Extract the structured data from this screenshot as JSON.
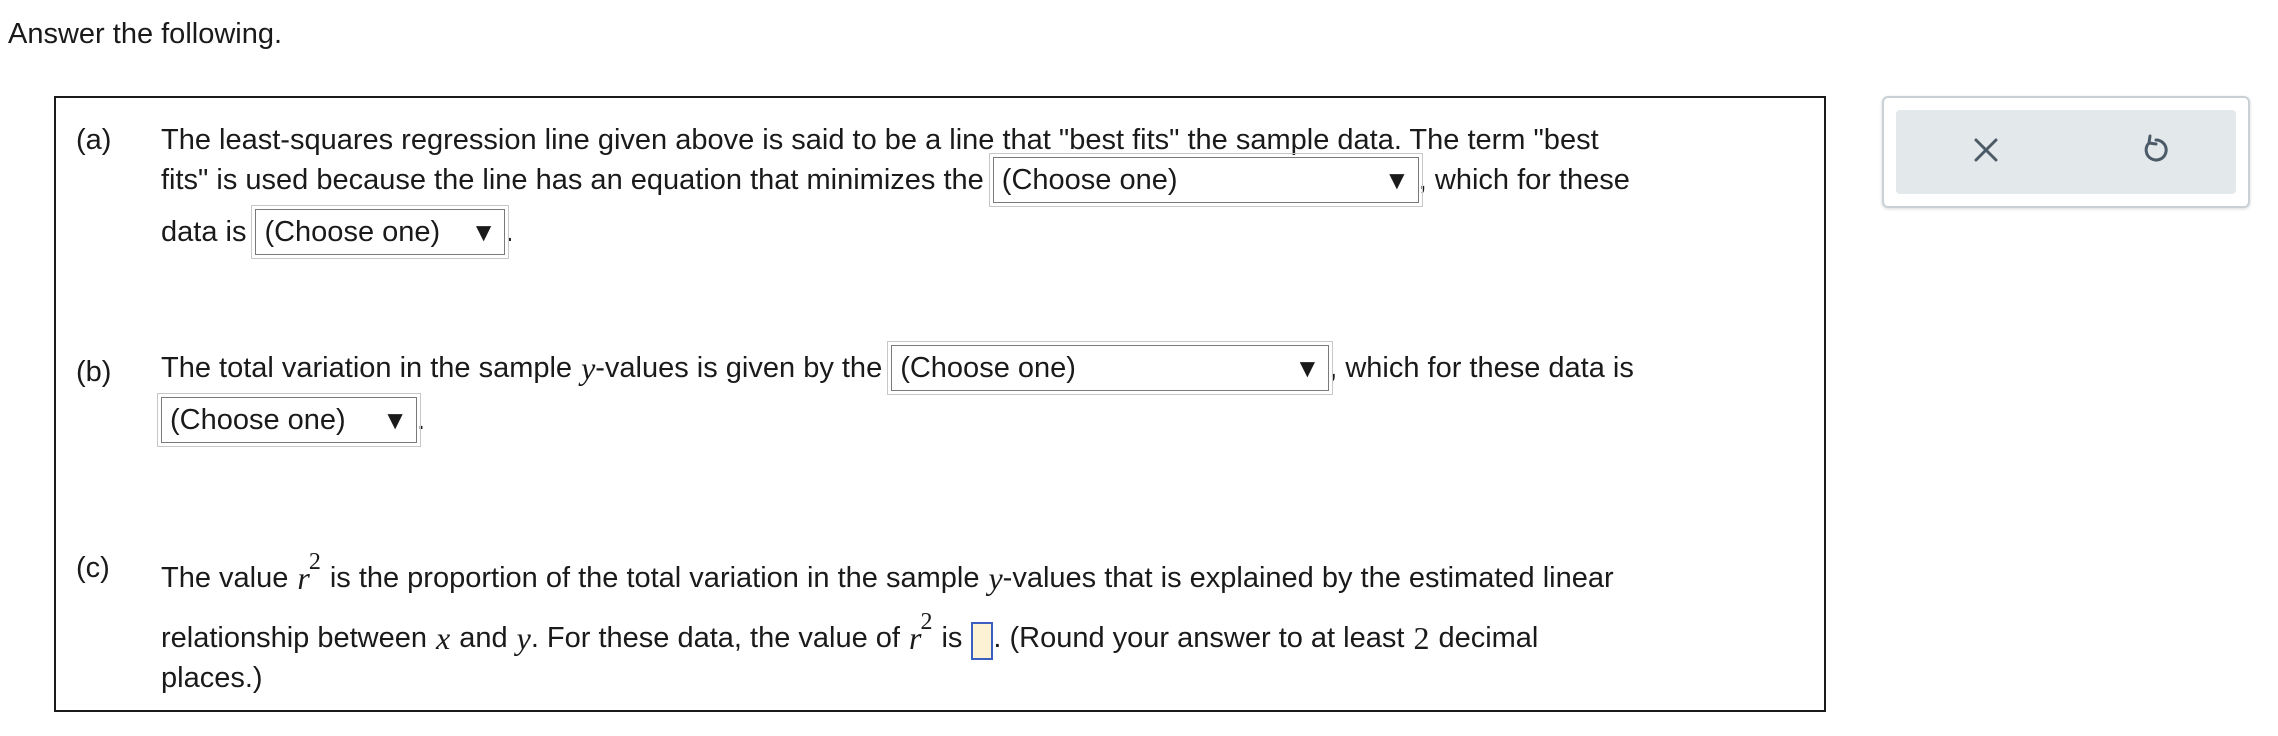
{
  "instruction": "Answer the following.",
  "parts": {
    "a": {
      "label": "(a)",
      "line1": "The least-squares regression line given above is said to be a line that \"best fits\" the sample data. The term \"best",
      "line2_pre": "fits\" is used because the line has an equation that minimizes the",
      "select1": "(Choose one)",
      "line2_post": ", which for these",
      "line3_pre": "data is",
      "select2": "(Choose one)",
      "line3_post": "."
    },
    "b": {
      "label": "(b)",
      "line1_pre": "The total variation in the sample",
      "var_y": "y",
      "line1_mid": "-values is given by the",
      "select1": "(Choose one)",
      "line1_post": ", which for these data is",
      "select2": "(Choose one)",
      "line2_post": "."
    },
    "c": {
      "label": "(c)",
      "line1_pre": "The value",
      "var_r": "r",
      "exp": "2",
      "line1_mid": "is the proportion of the total variation in the sample",
      "var_y": "y",
      "line1_post": "-values that is explained by the estimated linear",
      "line2_a": "relationship between",
      "var_x": "x",
      "line2_b": "and",
      "line2_c": ". For these data, the value of",
      "line2_d": "is",
      "line2_e": ". (Round your answer to at least",
      "num_2": "2",
      "line2_f": "decimal",
      "line3": "places.)"
    }
  },
  "tools": {
    "clear_icon": "×",
    "undo_icon": "undo-icon"
  },
  "colors": {
    "input_bg": "#fdf3d4",
    "input_border": "#3b5fc0",
    "tool_bg": "#e3e8eb"
  }
}
